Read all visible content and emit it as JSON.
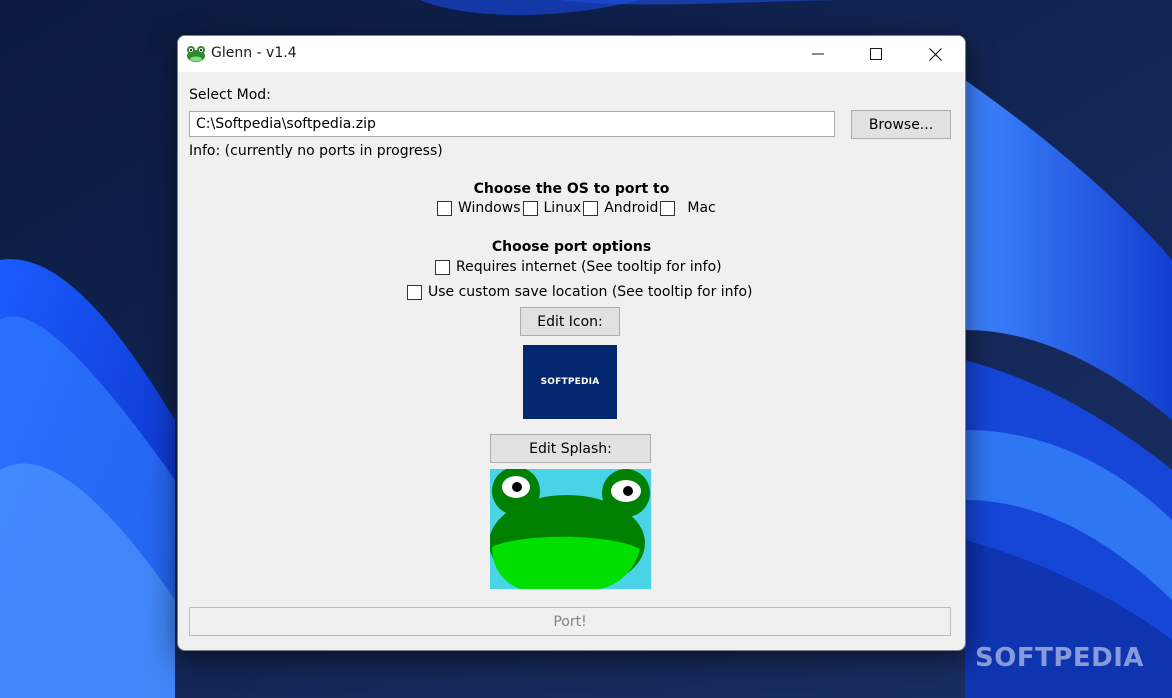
{
  "window": {
    "title": "Glenn - v1.4"
  },
  "mod": {
    "select_label": "Select Mod:",
    "path_value": "C:\\Softpedia\\softpedia.zip",
    "browse_label": "Browse...",
    "info_text": "Info: (currently no ports in progress)"
  },
  "os": {
    "heading": "Choose the OS to port to",
    "options": [
      {
        "label": "Windows",
        "checked": false
      },
      {
        "label": "Linux",
        "checked": false
      },
      {
        "label": "Android",
        "checked": false
      },
      {
        "label": "Mac",
        "checked": false
      }
    ]
  },
  "port_options": {
    "heading": "Choose port options",
    "requires_internet": {
      "label": "Requires internet (See tooltip for info)",
      "checked": false
    },
    "custom_save": {
      "label": "Use custom save location (See tooltip for info)",
      "checked": false
    }
  },
  "icon": {
    "edit_label": "Edit Icon:",
    "preview_text": "SOFTPEDIA"
  },
  "splash": {
    "edit_label": "Edit Splash:"
  },
  "port_button": "Port!",
  "watermark": "SOFTPEDIA",
  "colors": {
    "icon_bg": "#04266f",
    "splash_bg": "#48d4e6",
    "frog_dark": "#008000",
    "frog_light": "#00e000"
  }
}
